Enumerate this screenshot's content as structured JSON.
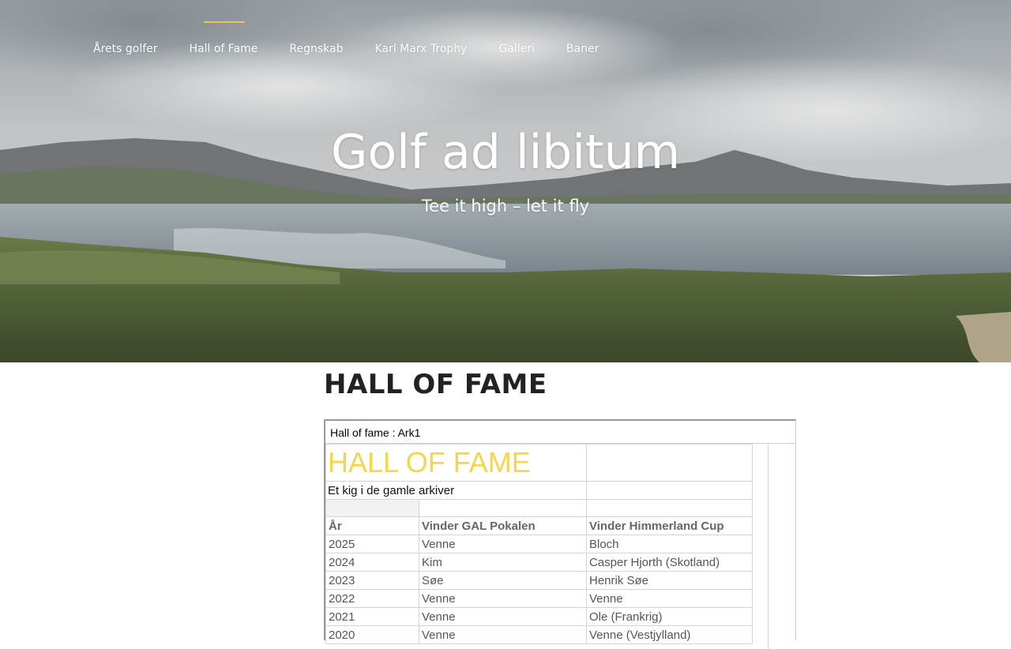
{
  "nav": {
    "items": [
      {
        "label": "Årets golfer",
        "active": false
      },
      {
        "label": "Hall of Fame",
        "active": true
      },
      {
        "label": "Regnskab",
        "active": false
      },
      {
        "label": "Karl Marx Trophy",
        "active": false
      },
      {
        "label": "Galleri",
        "active": false
      },
      {
        "label": "Baner",
        "active": false
      }
    ]
  },
  "hero": {
    "title": "Golf ad libitum",
    "tagline": "Tee it high – let it fly"
  },
  "page": {
    "heading": "HALL OF FAME"
  },
  "sheet": {
    "header": "Hall of fame : Ark1",
    "title": "HALL OF FAME",
    "subtitle": "Et kig i de gamle arkiver",
    "columns": [
      "År",
      "Vinder GAL Pokalen",
      "Vinder Himmerland Cup"
    ],
    "rows": [
      [
        "2025",
        "Venne",
        "Bloch"
      ],
      [
        "2024",
        "Kim",
        "Casper Hjorth (Skotland)"
      ],
      [
        "2023",
        "Søe",
        "Henrik Søe"
      ],
      [
        "2022",
        "Venne",
        "Venne"
      ],
      [
        "2021",
        "Venne",
        "Ole (Frankrig)"
      ],
      [
        "2020",
        "Venne",
        "Venne (Vestjylland)"
      ]
    ]
  },
  "colors": {
    "accent": "#e6c94a",
    "sheet_title": "#f5d64a"
  }
}
